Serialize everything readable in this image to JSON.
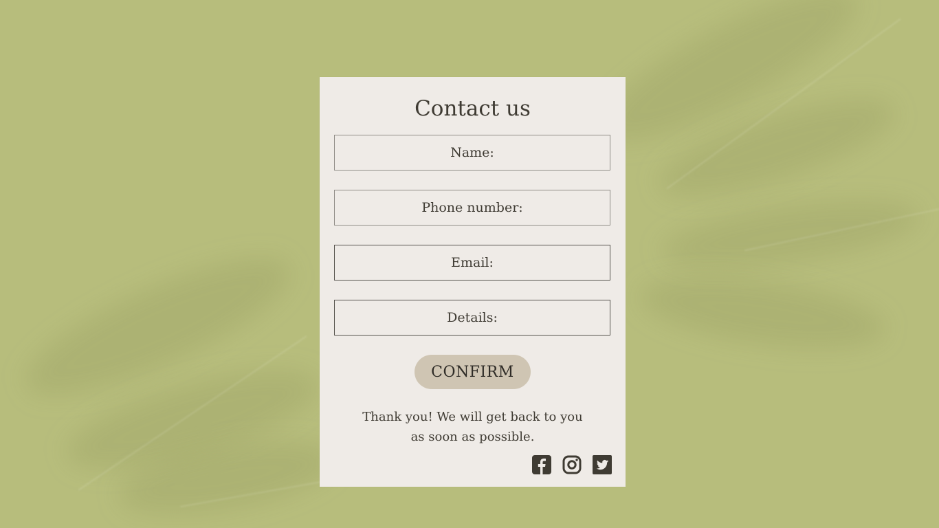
{
  "background_color": "#b7bd7c",
  "card_color": "#efebe7",
  "accent_color": "#cfc5b3",
  "text_color": "#3f3b33",
  "form": {
    "title": "Contact us",
    "fields": [
      {
        "label": "Name:"
      },
      {
        "label": "Phone number:"
      },
      {
        "label": "Email:"
      },
      {
        "label": "Details:"
      }
    ],
    "confirm_label": "CONFIRM",
    "message": "Thank you! We will get back to you as soon as possible."
  },
  "social": {
    "icons": [
      "facebook-icon",
      "instagram-icon",
      "twitter-icon"
    ]
  }
}
